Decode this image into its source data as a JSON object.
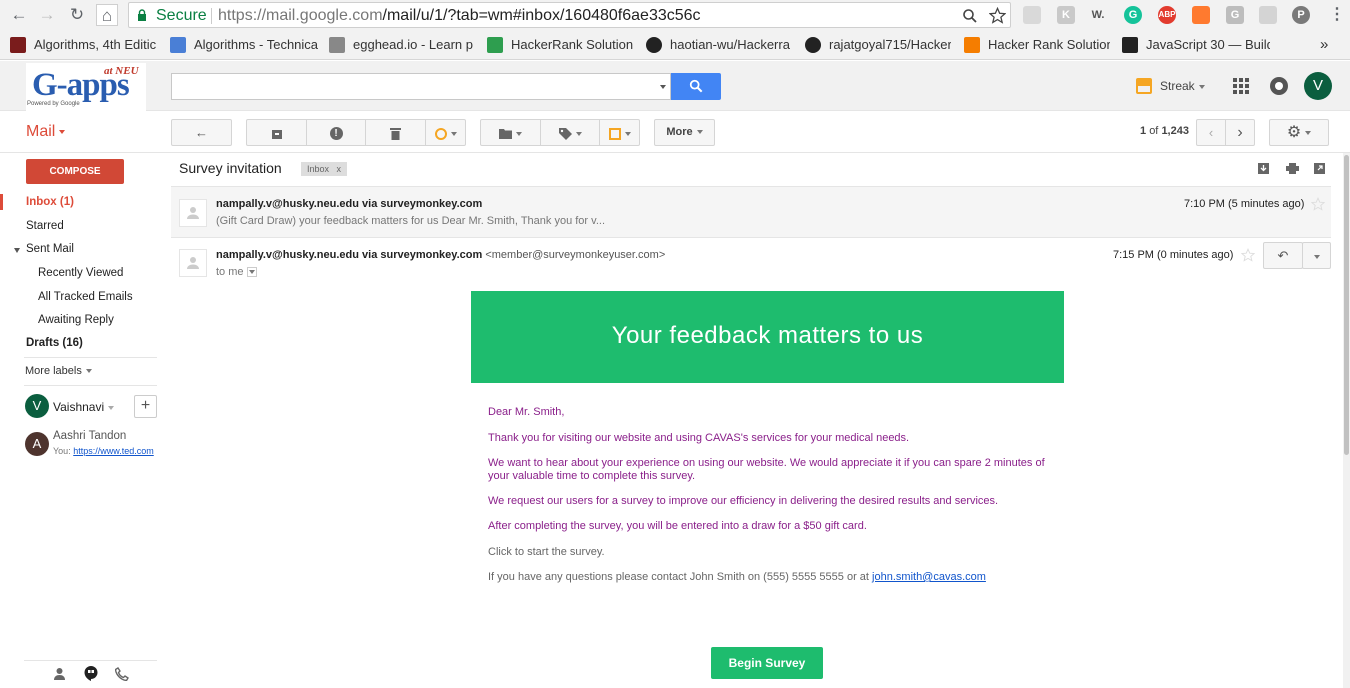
{
  "browser": {
    "secure_label": "Secure",
    "url_host": "https://mail.google.com",
    "url_path": "/mail/u/1/?tab=wm#inbox/160480f6ae33c56c"
  },
  "bookmarks": [
    {
      "label": "Algorithms, 4th Editic",
      "color": "#7a1c1c"
    },
    {
      "label": "Algorithms - Technica",
      "color": "#4a7fd6"
    },
    {
      "label": "egghead.io - Learn p",
      "color": "#888888"
    },
    {
      "label": "HackerRank Solution",
      "color": "#2e9e4f"
    },
    {
      "label": "haotian-wu/Hackerra",
      "color": "#222222"
    },
    {
      "label": "rajatgoyal715/Hacker",
      "color": "#222222"
    },
    {
      "label": "Hacker Rank Solution",
      "color": "#f57d00"
    },
    {
      "label": "JavaScript 30 — Build",
      "color": "#222222"
    }
  ],
  "bookmarks_overflow": "»",
  "header": {
    "logo_text": "G-apps",
    "logo_tag": "at NEU",
    "logo_sub": "Powered by Google",
    "streak_label": "Streak",
    "avatar_letter": "V"
  },
  "toolbar": {
    "mail_label": "Mail",
    "more_label": "More",
    "page_count": "1",
    "page_of": "of",
    "page_total": "1,243"
  },
  "sidebar": {
    "compose": "COMPOSE",
    "inbox": "Inbox (1)",
    "starred": "Starred",
    "sent": "Sent Mail",
    "recently_viewed": "Recently Viewed",
    "all_tracked": "All Tracked Emails",
    "awaiting_reply": "Awaiting Reply",
    "drafts": "Drafts (16)",
    "more_labels": "More labels",
    "user_name": "Vaishnavi",
    "user_letter": "V",
    "contact_name": "Aashri Tandon",
    "contact_letter": "A",
    "contact_prefix": "You:",
    "contact_link": "https://www.ted.com"
  },
  "thread": {
    "subject": "Survey invitation",
    "label": "Inbox",
    "label_x": "x"
  },
  "messages": [
    {
      "sender": "nampally.v@husky.neu.edu via surveymonkey.com",
      "snippet": "(Gift Card Draw) your feedback matters for us Dear Mr. Smith, Thank you for v...",
      "time": "7:10 PM (5 minutes ago)"
    },
    {
      "sender": "nampally.v@husky.neu.edu via surveymonkey.com",
      "sender_email": "<member@surveymonkeyuser.com>",
      "to": "to me",
      "time": "7:15 PM (0 minutes ago)"
    }
  ],
  "email": {
    "banner": "Your feedback matters to us",
    "banner_color": "#1ebc6e",
    "greeting": "Dear Mr. Smith,",
    "p1": "Thank you for visiting our website and using CAVAS's services for your medical needs.",
    "p2": "We want to hear about your experience on using our website. We would appreciate it if you can spare 2 minutes of your valuable time to complete this survey.",
    "p3": "We request our users for a survey to improve our efficiency in delivering the desired results and services.",
    "p4": "After completing the survey, you will be entered into a draw for a $50 gift card.",
    "p5": "Click to start the survey.",
    "p6": "If you have any questions please contact John Smith on (555) 5555 5555 or at",
    "p6_link": "john.smith@cavas.com",
    "cta": "Begin Survey"
  },
  "colors": {
    "accent_red": "#dd4b39",
    "search_blue": "#4285f4",
    "avatar_green": "#0b5e3f"
  }
}
